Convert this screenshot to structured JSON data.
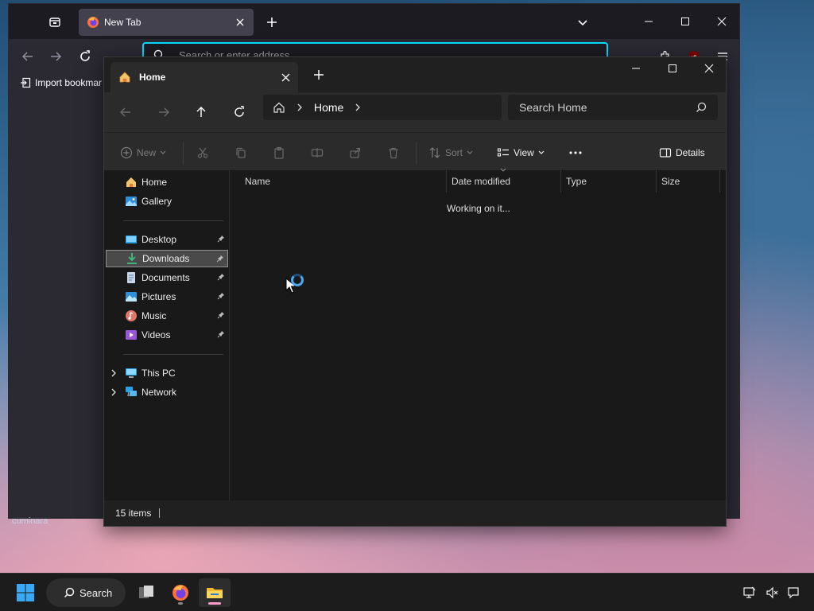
{
  "firefox": {
    "tab_title": "New Tab",
    "url_placeholder": "Search or enter address",
    "bookmark_import": "Import bookmar",
    "fragment_text": "cuminara"
  },
  "explorer": {
    "tab_title": "Home",
    "breadcrumb": [
      "Home"
    ],
    "search_placeholder": "Search Home",
    "commands": {
      "new": "New",
      "sort": "Sort",
      "view": "View",
      "details": "Details"
    },
    "nav": {
      "quick": [
        {
          "label": "Home",
          "icon": "home-icon"
        },
        {
          "label": "Gallery",
          "icon": "gallery-icon"
        }
      ],
      "pinned": [
        {
          "label": "Desktop",
          "icon": "desktop-folder-icon"
        },
        {
          "label": "Downloads",
          "icon": "download-folder-icon"
        },
        {
          "label": "Documents",
          "icon": "documents-folder-icon"
        },
        {
          "label": "Pictures",
          "icon": "pictures-folder-icon"
        },
        {
          "label": "Music",
          "icon": "music-folder-icon"
        },
        {
          "label": "Videos",
          "icon": "videos-folder-icon"
        }
      ],
      "tree": [
        {
          "label": "This PC",
          "icon": "this-pc-icon"
        },
        {
          "label": "Network",
          "icon": "network-icon"
        }
      ],
      "selected": "Downloads"
    },
    "columns": [
      "Name",
      "Date modified",
      "Type",
      "Size"
    ],
    "loading_text": "Working on it...",
    "status": "15 items"
  },
  "taskbar": {
    "search_label": "Search",
    "apps": [
      "start-icon",
      "search",
      "task-view-icon",
      "firefox-icon",
      "file-explorer-icon"
    ],
    "tray": [
      "network-icon",
      "volume-muted-icon",
      "notification-icon"
    ]
  },
  "colors": {
    "accent": "#00ddff",
    "selection": "#4a4a4a",
    "active_indicator": "#ff9acb"
  }
}
